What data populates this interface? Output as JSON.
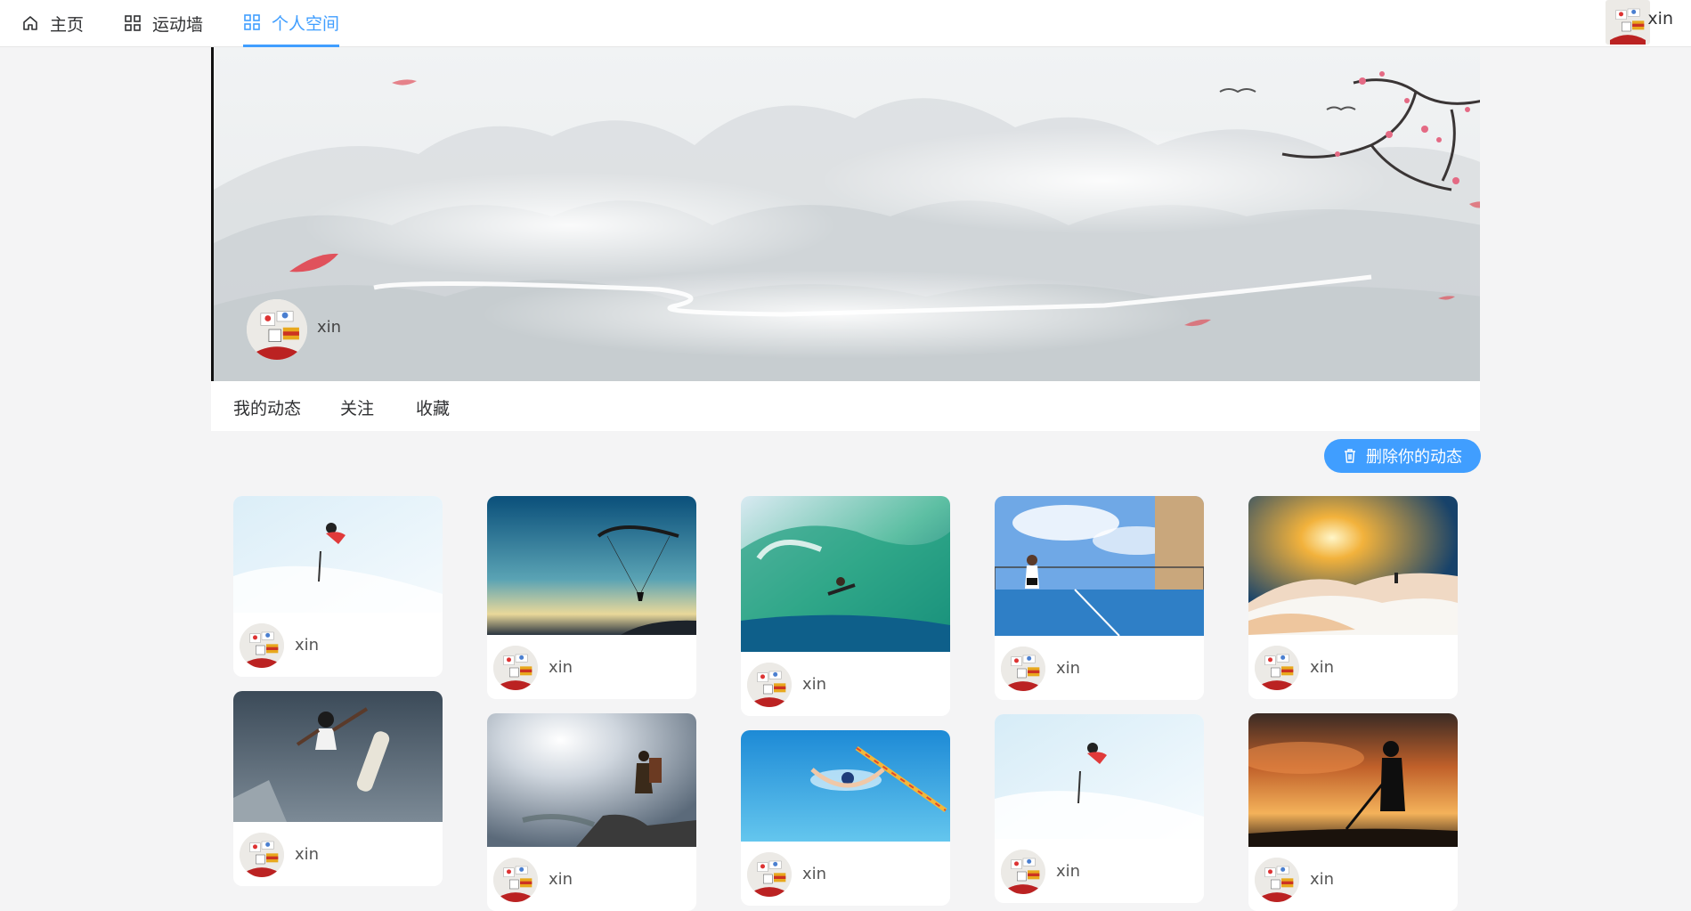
{
  "nav": {
    "items": [
      {
        "label": "主页",
        "icon": "home-icon"
      },
      {
        "label": "运动墙",
        "icon": "grid-icon"
      },
      {
        "label": "个人空间",
        "icon": "grid-icon"
      }
    ],
    "active_index": 2,
    "username": "xin",
    "accent_color": "#409eff"
  },
  "profile": {
    "username": "xin"
  },
  "tabs": [
    {
      "label": "我的动态"
    },
    {
      "label": "关注"
    },
    {
      "label": "收藏"
    }
  ],
  "actions": {
    "delete_label": "删除你的动态",
    "delete_icon": "trash-icon"
  },
  "posts": [
    {
      "author": "xin",
      "scene": "skiing"
    },
    {
      "author": "xin",
      "scene": "paragliding"
    },
    {
      "author": "xin",
      "scene": "surfing"
    },
    {
      "author": "xin",
      "scene": "tennis-court"
    },
    {
      "author": "xin",
      "scene": "mountain-sunrise"
    },
    {
      "author": "xin",
      "scene": "skateboarding"
    },
    {
      "author": "xin",
      "scene": "hiker-cliff"
    },
    {
      "author": "xin",
      "scene": "swimming"
    },
    {
      "author": "xin",
      "scene": "skiing"
    },
    {
      "author": "xin",
      "scene": "golf-sunset"
    }
  ]
}
